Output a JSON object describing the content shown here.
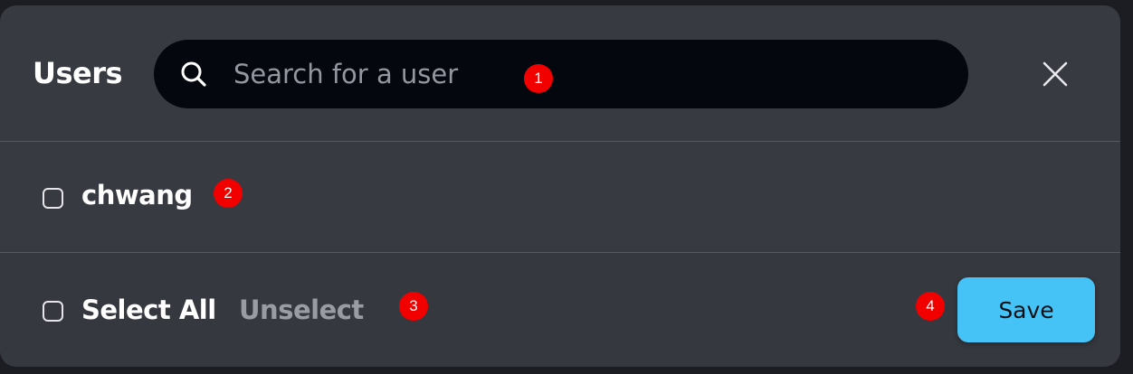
{
  "header": {
    "title": "Users",
    "search_placeholder": "Search for a user",
    "search_value": ""
  },
  "users": [
    {
      "name": "chwang",
      "checked": false
    }
  ],
  "footer": {
    "select_all_label": "Select All",
    "unselect_label": "Unselect",
    "save_label": "Save"
  },
  "annotations": [
    "1",
    "2",
    "3",
    "4"
  ],
  "colors": {
    "dialog_bg": "#383a42",
    "search_bg": "#05070e",
    "save_bg": "#45c3f7",
    "marker": "#f20000"
  },
  "icons": {
    "search": "search-icon",
    "close": "close-icon"
  }
}
